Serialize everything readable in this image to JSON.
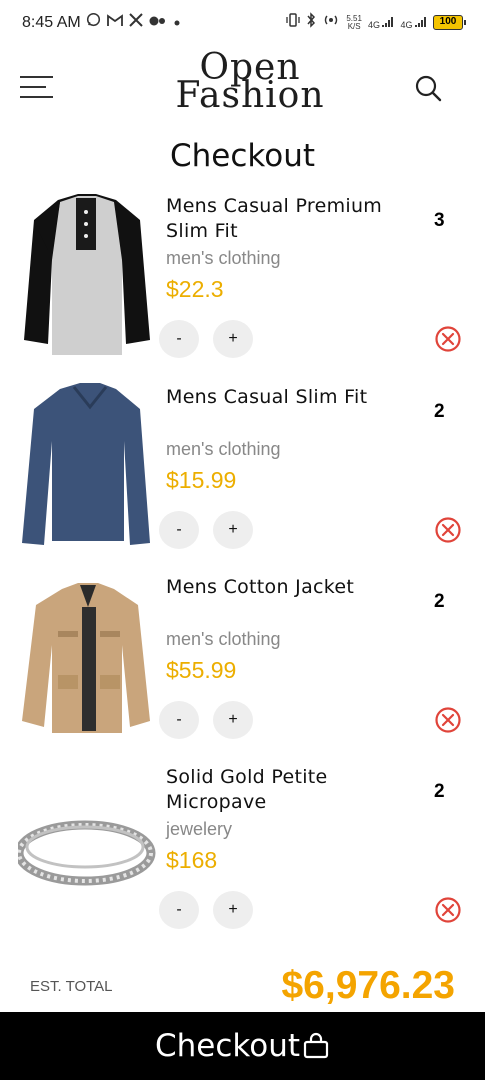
{
  "status_bar": {
    "time": "8:45 AM",
    "net_speed_top": "5.51",
    "net_speed_bottom": "K/S",
    "net_a": "4G",
    "net_b": "4G",
    "battery": "100"
  },
  "header": {
    "logo_line1": "Open",
    "logo_line2": "Fashion"
  },
  "page_title": "Checkout",
  "colors": {
    "price": "#ecae00",
    "total": "#f4a400",
    "remove": "#e0443a",
    "checkout_bar": "#000000"
  },
  "cart": {
    "minus_label": "-",
    "plus_label": "+",
    "items": [
      {
        "name": "Mens Casual Premium Slim Fit",
        "category": "men's clothing",
        "price": "$22.3",
        "quantity": "3",
        "image_icon": "henley-shirt"
      },
      {
        "name": "Mens Casual Slim Fit",
        "category": "men's clothing",
        "price": "$15.99",
        "quantity": "2",
        "image_icon": "navy-longsleeve"
      },
      {
        "name": "Mens Cotton Jacket",
        "category": "men's clothing",
        "price": "$55.99",
        "quantity": "2",
        "image_icon": "khaki-jacket"
      },
      {
        "name": "Solid Gold Petite Micropave",
        "category": "jewelery",
        "price": "$168",
        "quantity": "2",
        "image_icon": "silver-ring"
      }
    ]
  },
  "footer": {
    "total_label": "EST. TOTAL",
    "total_value": "$6,976.23",
    "checkout_label": "Checkout"
  }
}
